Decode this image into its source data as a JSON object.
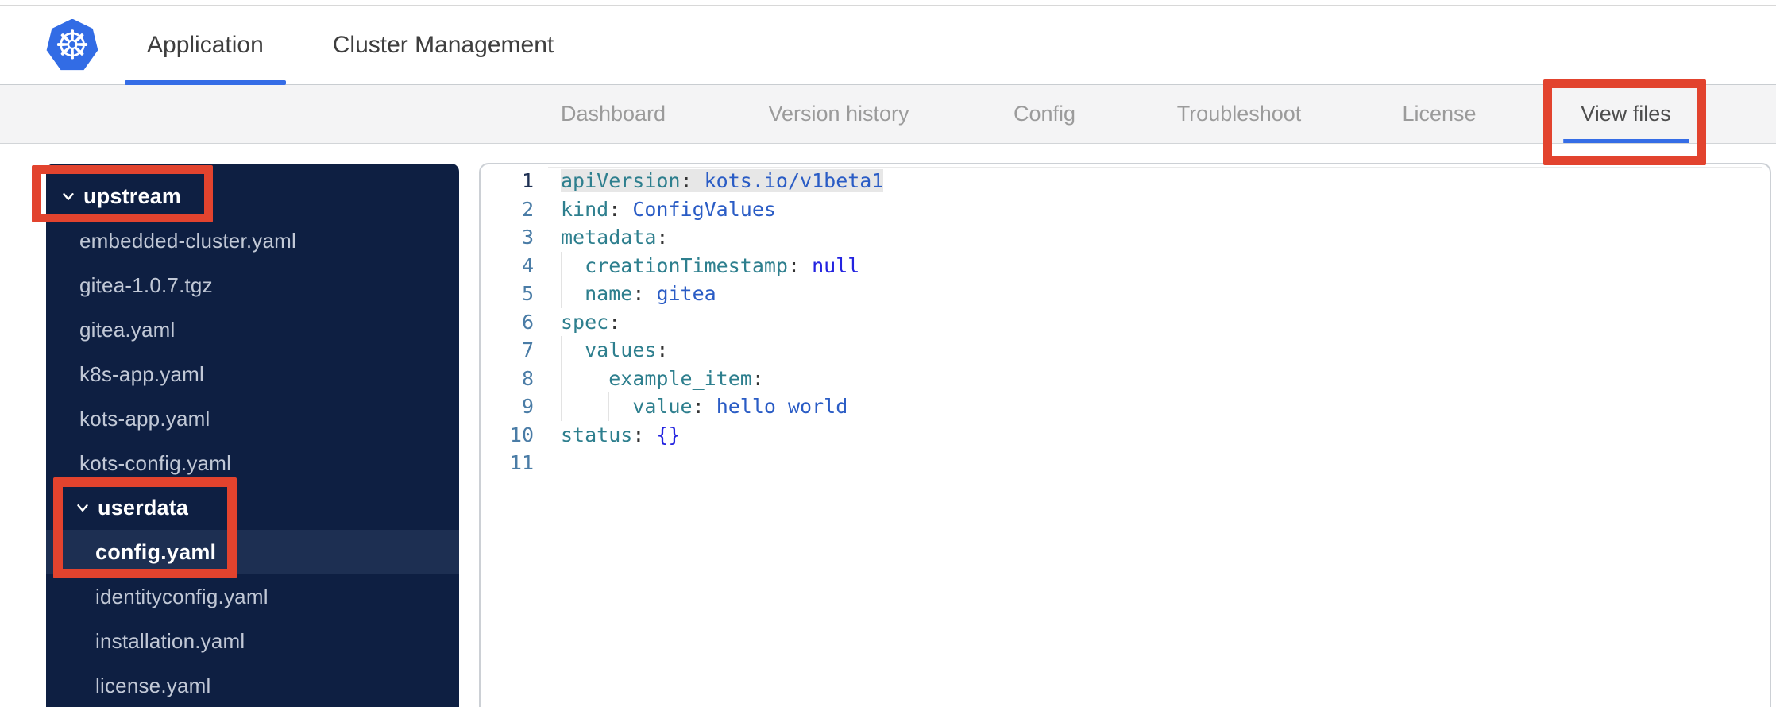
{
  "brand": {
    "logo_glyph": "☸",
    "logo_icon": "kubernetes-wheel"
  },
  "header": {
    "tabs": [
      {
        "label": "Application",
        "active": true
      },
      {
        "label": "Cluster Management",
        "active": false
      }
    ]
  },
  "subnav": {
    "tabs": [
      {
        "label": "Dashboard",
        "active": false
      },
      {
        "label": "Version history",
        "active": false
      },
      {
        "label": "Config",
        "active": false
      },
      {
        "label": "Troubleshoot",
        "active": false
      },
      {
        "label": "License",
        "active": false
      },
      {
        "label": "View files",
        "active": true
      }
    ]
  },
  "file_tree": {
    "items": [
      {
        "label": "upstream",
        "kind": "folder",
        "depth": 0,
        "expanded": true,
        "selected": false
      },
      {
        "label": "embedded-cluster.yaml",
        "kind": "file",
        "depth": 1,
        "selected": false
      },
      {
        "label": "gitea-1.0.7.tgz",
        "kind": "file",
        "depth": 1,
        "selected": false
      },
      {
        "label": "gitea.yaml",
        "kind": "file",
        "depth": 1,
        "selected": false
      },
      {
        "label": "k8s-app.yaml",
        "kind": "file",
        "depth": 1,
        "selected": false
      },
      {
        "label": "kots-app.yaml",
        "kind": "file",
        "depth": 1,
        "selected": false
      },
      {
        "label": "kots-config.yaml",
        "kind": "file",
        "depth": 1,
        "selected": false
      },
      {
        "label": "userdata",
        "kind": "folder",
        "depth": 1,
        "expanded": true,
        "selected": false
      },
      {
        "label": "config.yaml",
        "kind": "file",
        "depth": 2,
        "selected": true
      },
      {
        "label": "identityconfig.yaml",
        "kind": "file",
        "depth": 2,
        "selected": false
      },
      {
        "label": "installation.yaml",
        "kind": "file",
        "depth": 2,
        "selected": false
      },
      {
        "label": "license.yaml",
        "kind": "file",
        "depth": 2,
        "selected": false
      }
    ]
  },
  "editor": {
    "lines": [
      {
        "num": "1",
        "guides": 0,
        "active": true,
        "selected": true,
        "tokens": [
          [
            "k",
            "apiVersion"
          ],
          [
            "p",
            ": "
          ],
          [
            "v",
            "kots.io/v1beta1"
          ]
        ]
      },
      {
        "num": "2",
        "guides": 0,
        "tokens": [
          [
            "k",
            "kind"
          ],
          [
            "p",
            ": "
          ],
          [
            "v",
            "ConfigValues"
          ]
        ]
      },
      {
        "num": "3",
        "guides": 0,
        "tokens": [
          [
            "k",
            "metadata"
          ],
          [
            "p",
            ":"
          ]
        ]
      },
      {
        "num": "4",
        "guides": 1,
        "tokens": [
          [
            "p",
            "  "
          ],
          [
            "k",
            "creationTimestamp"
          ],
          [
            "p",
            ": "
          ],
          [
            "b",
            "null"
          ]
        ]
      },
      {
        "num": "5",
        "guides": 1,
        "tokens": [
          [
            "p",
            "  "
          ],
          [
            "k",
            "name"
          ],
          [
            "p",
            ": "
          ],
          [
            "v",
            "gitea"
          ]
        ]
      },
      {
        "num": "6",
        "guides": 0,
        "tokens": [
          [
            "k",
            "spec"
          ],
          [
            "p",
            ":"
          ]
        ]
      },
      {
        "num": "7",
        "guides": 1,
        "tokens": [
          [
            "p",
            "  "
          ],
          [
            "k",
            "values"
          ],
          [
            "p",
            ":"
          ]
        ]
      },
      {
        "num": "8",
        "guides": 2,
        "tokens": [
          [
            "p",
            "    "
          ],
          [
            "k",
            "example_item"
          ],
          [
            "p",
            ":"
          ]
        ]
      },
      {
        "num": "9",
        "guides": 3,
        "tokens": [
          [
            "p",
            "      "
          ],
          [
            "k",
            "value"
          ],
          [
            "p",
            ": "
          ],
          [
            "v",
            "hello world"
          ]
        ]
      },
      {
        "num": "10",
        "guides": 0,
        "tokens": [
          [
            "k",
            "status"
          ],
          [
            "p",
            ": "
          ],
          [
            "b",
            "{}"
          ]
        ]
      },
      {
        "num": "11",
        "guides": 0,
        "tokens": []
      }
    ]
  },
  "annotations": {
    "color": "#e2432e",
    "boxes": [
      "upstream-folder",
      "userdata-and-config-yaml",
      "view-files-tab"
    ]
  },
  "colors": {
    "kubernetes_blue": "#326ce5",
    "accent_blue": "#356de6",
    "annotation_red": "#e2432e",
    "sidebar_bg": "#0e1f42",
    "sidebar_selected_bg": "#1d2f52",
    "yaml_key": "#2e7f8e",
    "yaml_value": "#2a5cc5",
    "yaml_keyword": "#2323e0",
    "line_number": "#4a7ca6"
  }
}
